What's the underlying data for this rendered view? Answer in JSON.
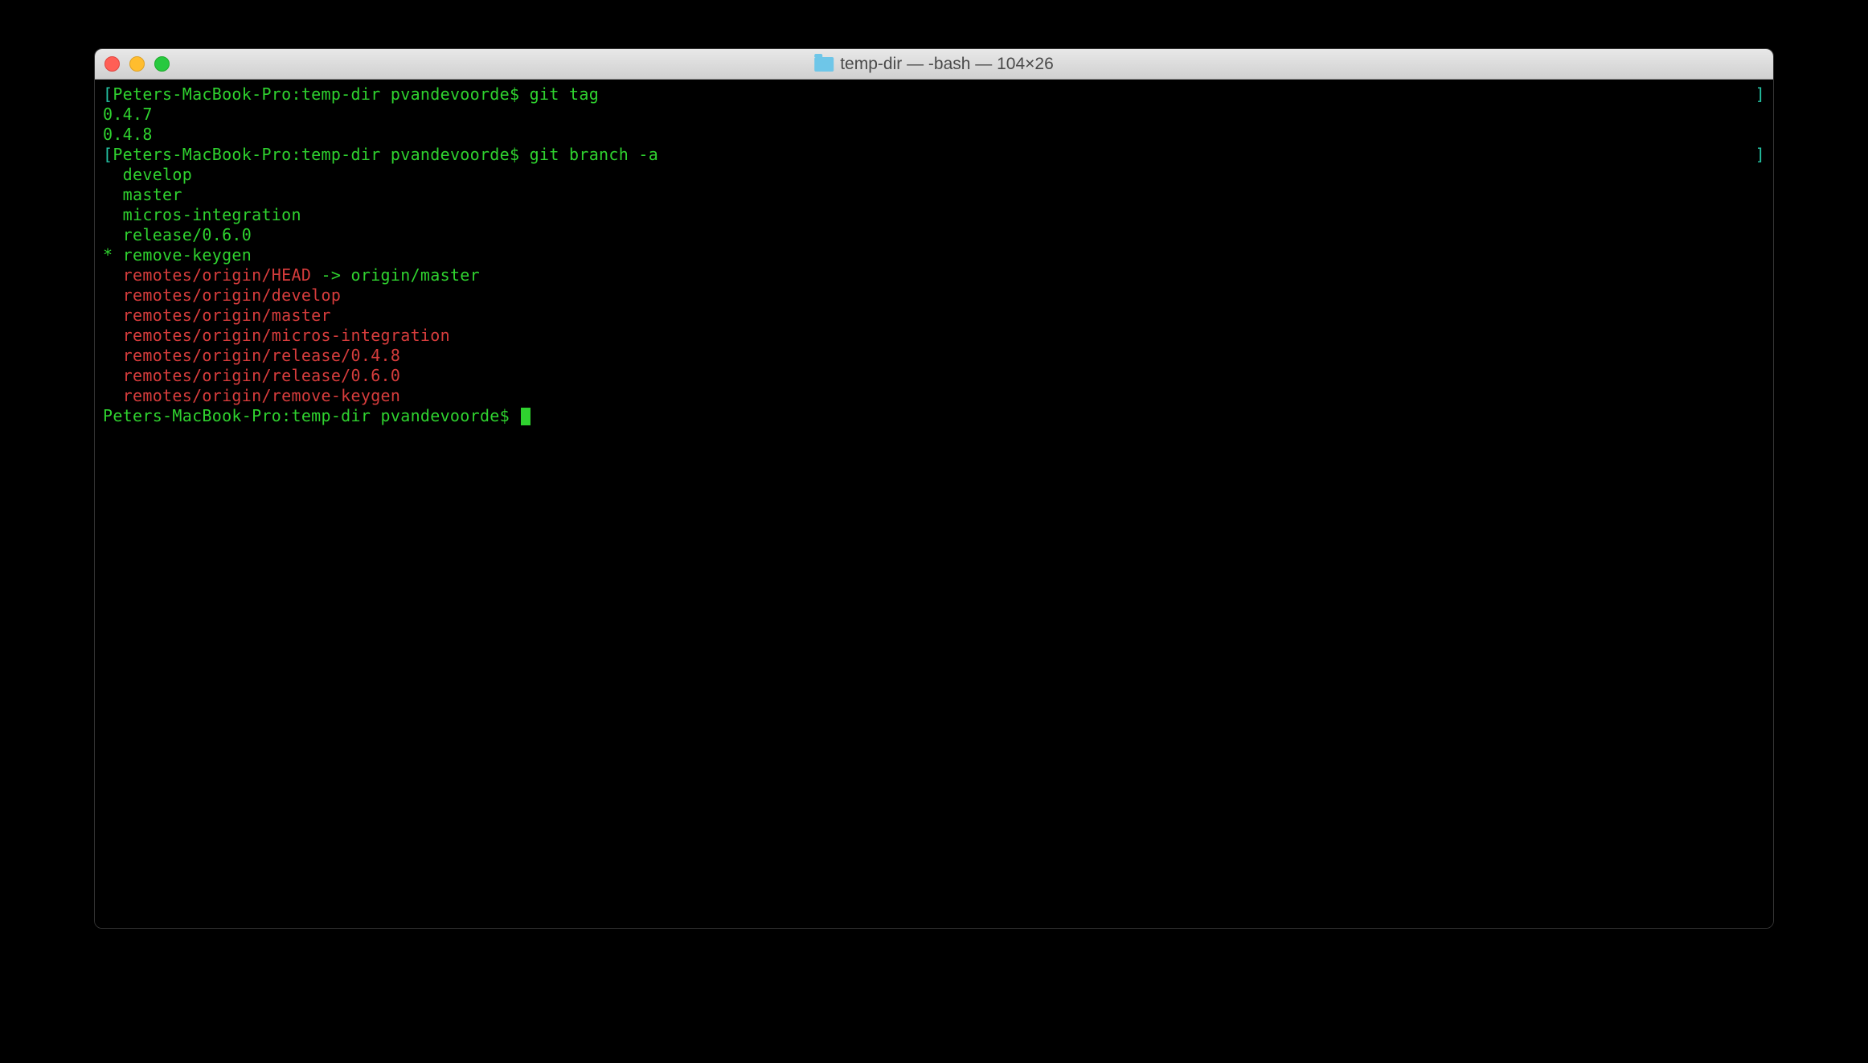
{
  "titlebar": {
    "title": "temp-dir — -bash — 104×26"
  },
  "terminal": {
    "lines": [
      {
        "segments": [
          {
            "text": "[",
            "cls": "teal"
          },
          {
            "text": "Peters-MacBook-Pro:temp-dir pvandevoorde$ git tag",
            "cls": "green"
          }
        ],
        "trailing": "]"
      },
      {
        "segments": [
          {
            "text": "0.4.7",
            "cls": "green"
          }
        ]
      },
      {
        "segments": [
          {
            "text": "0.4.8",
            "cls": "green"
          }
        ]
      },
      {
        "segments": [
          {
            "text": "[",
            "cls": "teal"
          },
          {
            "text": "Peters-MacBook-Pro:temp-dir pvandevoorde$ git branch -a",
            "cls": "green"
          }
        ],
        "trailing": "]"
      },
      {
        "segments": [
          {
            "text": "  develop",
            "cls": "green"
          }
        ]
      },
      {
        "segments": [
          {
            "text": "  master",
            "cls": "green"
          }
        ]
      },
      {
        "segments": [
          {
            "text": "  micros-integration",
            "cls": "green"
          }
        ]
      },
      {
        "segments": [
          {
            "text": "  release/0.6.0",
            "cls": "green"
          }
        ]
      },
      {
        "segments": [
          {
            "text": "* remove-keygen",
            "cls": "green"
          }
        ]
      },
      {
        "segments": [
          {
            "text": "  remotes/origin/HEAD",
            "cls": "red"
          },
          {
            "text": " -> origin/master",
            "cls": "green"
          }
        ]
      },
      {
        "segments": [
          {
            "text": "  remotes/origin/develop",
            "cls": "red"
          }
        ]
      },
      {
        "segments": [
          {
            "text": "  remotes/origin/master",
            "cls": "red"
          }
        ]
      },
      {
        "segments": [
          {
            "text": "  remotes/origin/micros-integration",
            "cls": "red"
          }
        ]
      },
      {
        "segments": [
          {
            "text": "  remotes/origin/release/0.4.8",
            "cls": "red"
          }
        ]
      },
      {
        "segments": [
          {
            "text": "  remotes/origin/release/0.6.0",
            "cls": "red"
          }
        ]
      },
      {
        "segments": [
          {
            "text": "  remotes/origin/remove-keygen",
            "cls": "red"
          }
        ]
      },
      {
        "segments": [
          {
            "text": "Peters-MacBook-Pro:temp-dir pvandevoorde$ ",
            "cls": "green"
          }
        ],
        "cursor": true
      }
    ]
  }
}
